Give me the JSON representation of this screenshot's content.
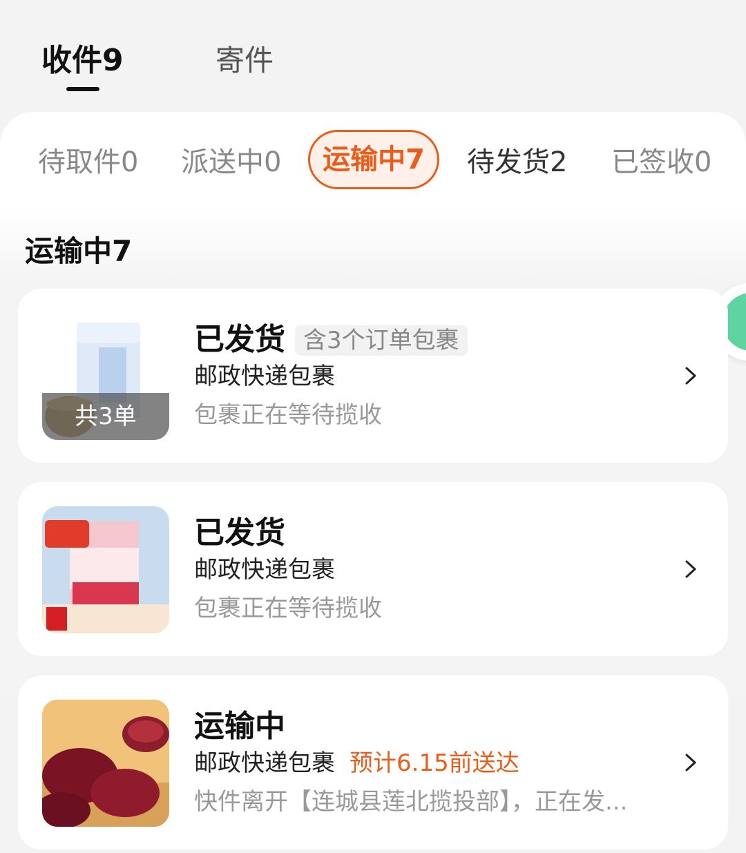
{
  "top_tabs": {
    "receive": "收件9",
    "send": "寄件"
  },
  "filters": [
    {
      "label": "待取件0"
    },
    {
      "label": "派送中0"
    },
    {
      "label": "运输中7"
    },
    {
      "label": "待发货2"
    },
    {
      "label": "已签收0"
    }
  ],
  "section_title": "运输中7",
  "cards": [
    {
      "status": "已发货",
      "chip": "含3个订单包裹",
      "carrier": "邮政快递包裹",
      "detail": "包裹正在等待揽收",
      "badge": "共3单"
    },
    {
      "status": "已发货",
      "carrier": "邮政快递包裹",
      "detail": "包裹正在等待揽收"
    },
    {
      "status": "运输中",
      "carrier": "邮政快递包裹",
      "eta": "预计6.15前送达",
      "detail": "快件离开【连城县莲北揽投部】，正在发..."
    }
  ],
  "colors": {
    "accent": "#ea5c19",
    "float_button": "#5fd3a1"
  },
  "icons": {
    "chevron": "chevron-right-icon",
    "float": "chat-icon"
  }
}
